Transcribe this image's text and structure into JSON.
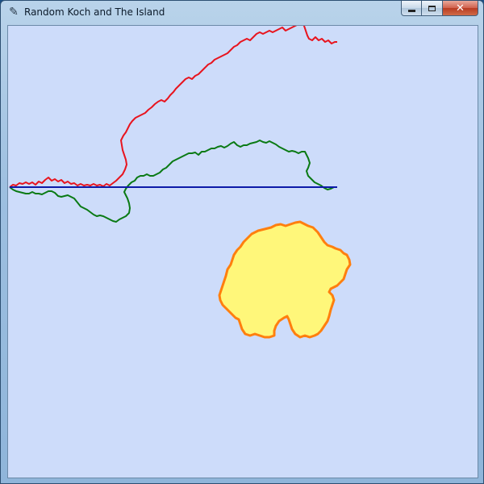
{
  "window": {
    "title": "Random Koch and The Island",
    "app_icon": "feather-icon",
    "buttons": {
      "minimize": "minimize-icon",
      "maximize": "maximize-icon",
      "close": "close-icon"
    }
  },
  "canvas": {
    "background": "#cddcfa",
    "curves": [
      {
        "name": "red",
        "color": "#e8141e"
      },
      {
        "name": "green",
        "color": "#0a7a14"
      },
      {
        "name": "blue",
        "color": "#0c1aa8"
      }
    ],
    "island": {
      "fill": "#fff77a",
      "outline": "#ff7f0e"
    }
  }
}
